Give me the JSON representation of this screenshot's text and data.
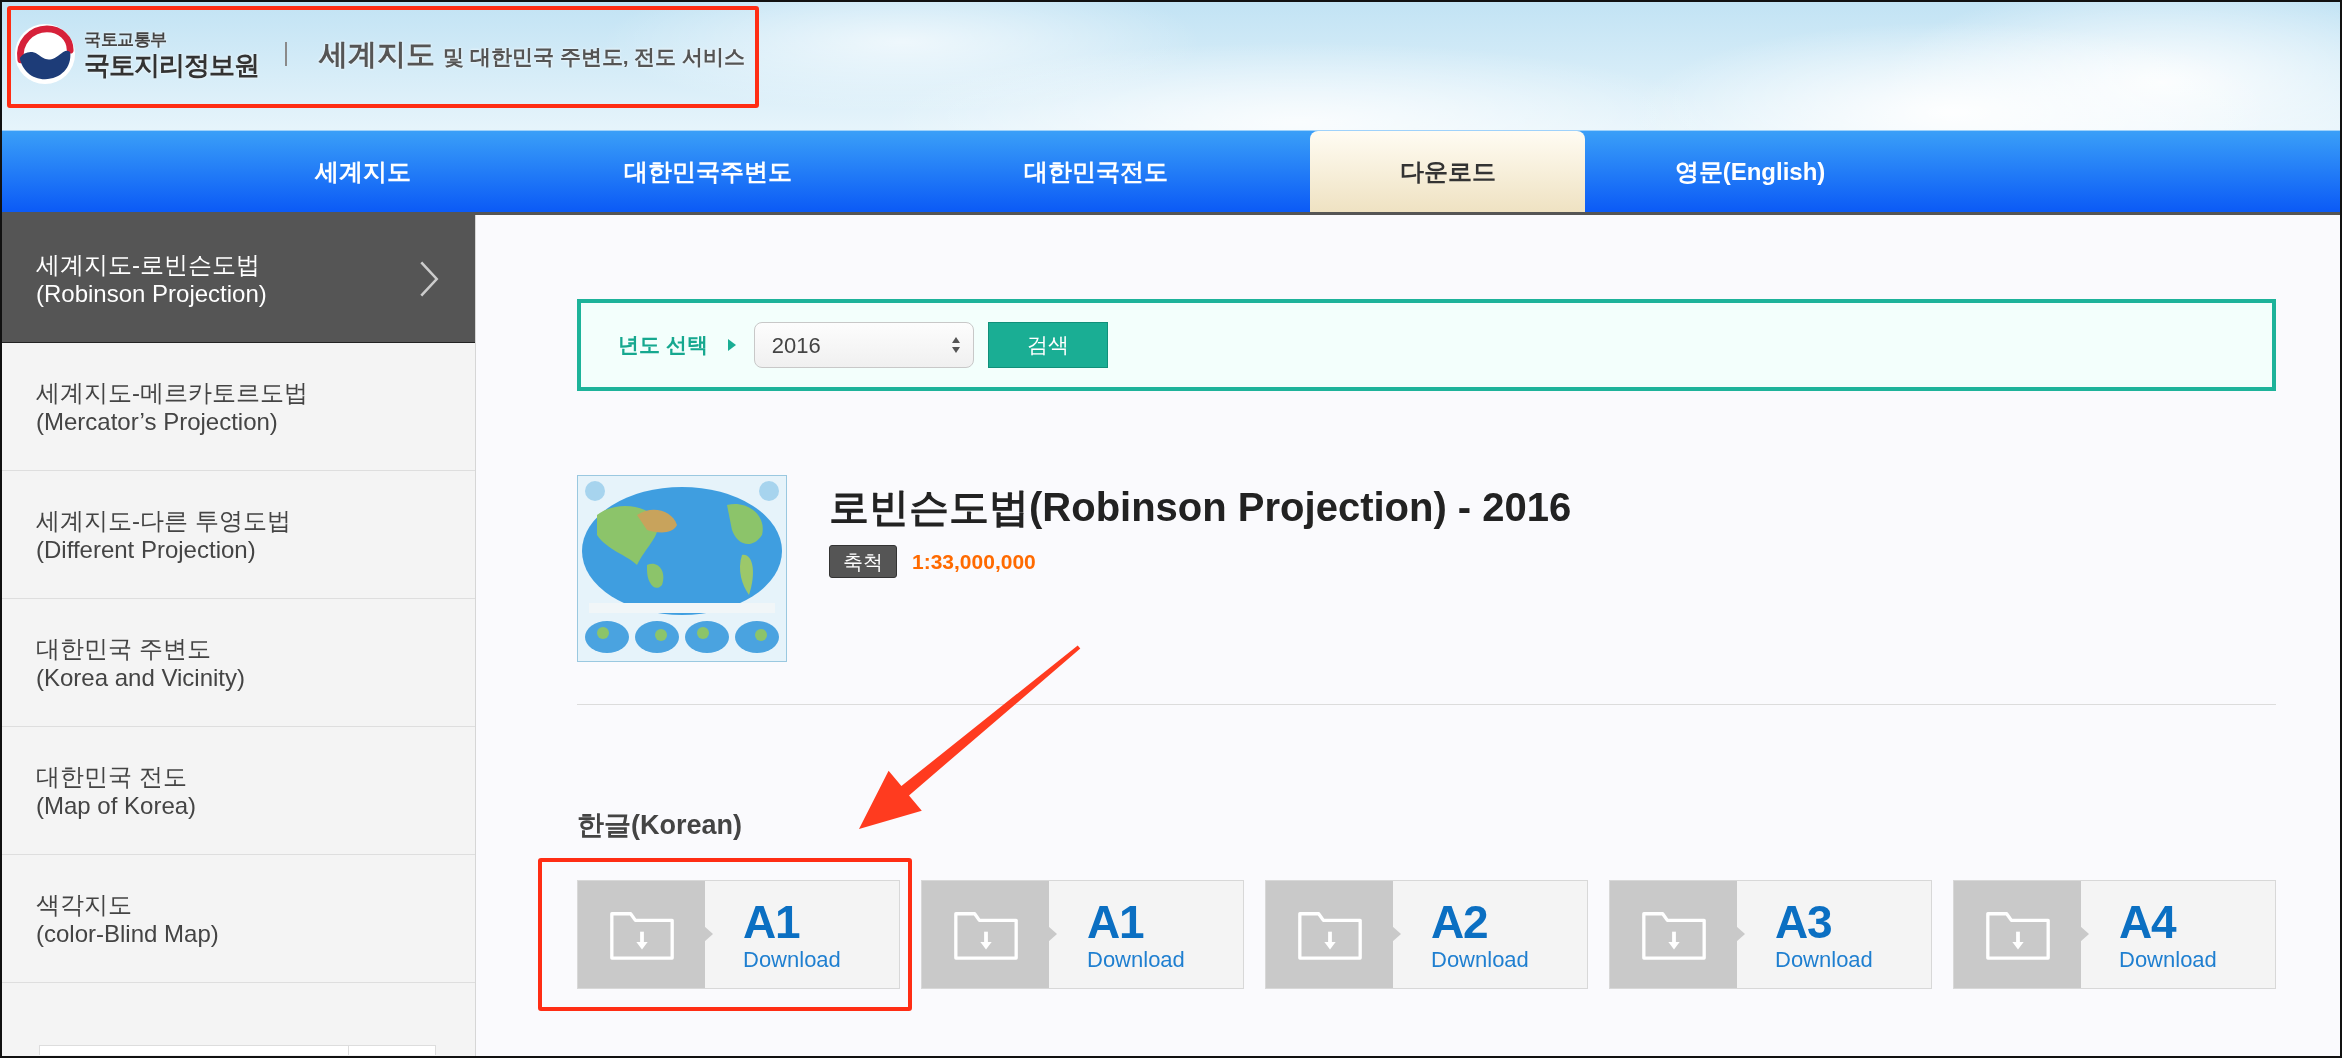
{
  "header": {
    "highlighted": true,
    "ministry": "국토교통부",
    "agency": "국토지리정보원",
    "title_lead": "세계지도",
    "title_rest": "및 대한민국 주변도, 전도 서비스"
  },
  "tabs": [
    {
      "label": "세계지도",
      "selected": false
    },
    {
      "label": "대한민국주변도",
      "selected": false
    },
    {
      "label": "대한민국전도",
      "selected": false
    },
    {
      "label": "다운로드",
      "selected": true
    },
    {
      "label": "영문(English)",
      "selected": false
    }
  ],
  "sidebar": {
    "items": [
      {
        "title": "세계지도-로빈슨도법",
        "subtitle": "(Robinson Projection)",
        "selected": true
      },
      {
        "title": "세계지도-메르카토르도법",
        "subtitle": "(Mercator’s Projection)",
        "selected": false
      },
      {
        "title": "세계지도-다른 투영도법",
        "subtitle": "(Different Projection)",
        "selected": false
      },
      {
        "title": "대한민국 주변도",
        "subtitle": "(Korea and Vicinity)",
        "selected": false
      },
      {
        "title": "대한민국 전도",
        "subtitle": "(Map of Korea)",
        "selected": false
      },
      {
        "title": "색각지도",
        "subtitle": "(color-Blind Map)",
        "selected": false
      }
    ]
  },
  "year_filter": {
    "label": "년도 선택",
    "value": "2016",
    "button": "검색"
  },
  "map": {
    "title": "로빈슨도법(Robinson Projection) - 2016",
    "scale_label": "축척",
    "scale": "1:33,000,000"
  },
  "downloads": {
    "heading": "한글(Korean)",
    "items": [
      {
        "size": "A1",
        "label": "Download",
        "highlighted": true
      },
      {
        "size": "A1",
        "label": "Download",
        "highlighted": false
      },
      {
        "size": "A2",
        "label": "Download",
        "highlighted": false
      },
      {
        "size": "A3",
        "label": "Download",
        "highlighted": false
      },
      {
        "size": "A4",
        "label": "Download",
        "highlighted": false
      }
    ]
  }
}
